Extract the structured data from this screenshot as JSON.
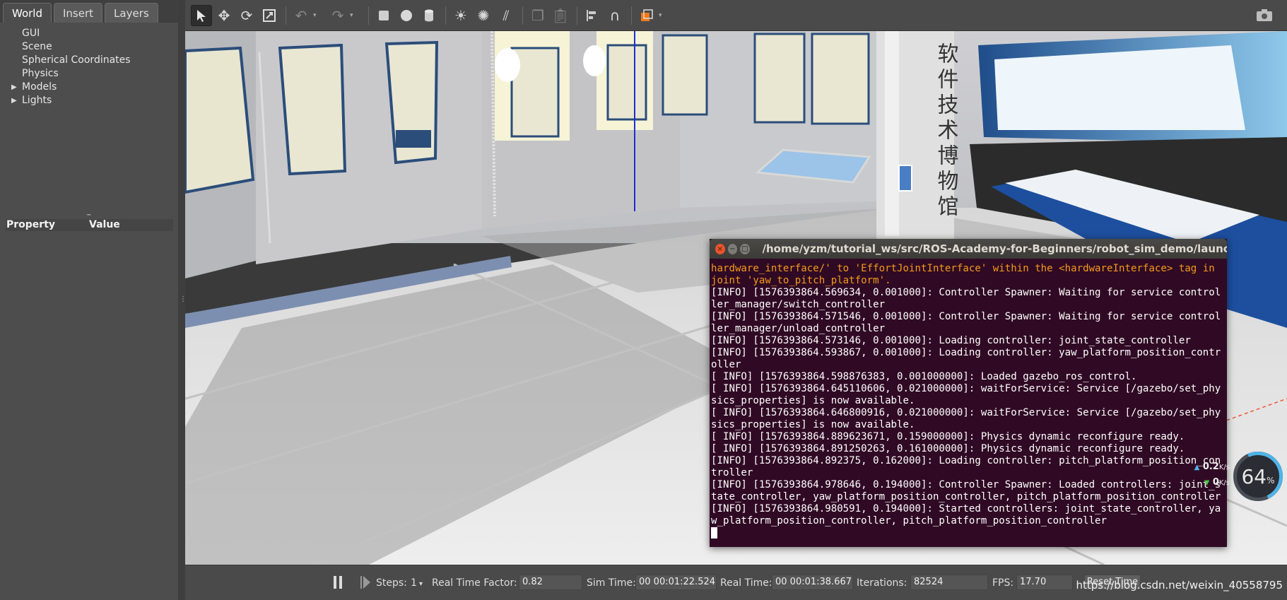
{
  "left_panel": {
    "tabs": [
      "World",
      "Insert",
      "Layers"
    ],
    "tree": [
      {
        "label": "GUI",
        "expandable": false
      },
      {
        "label": "Scene",
        "expandable": false
      },
      {
        "label": "Spherical Coordinates",
        "expandable": false
      },
      {
        "label": "Physics",
        "expandable": false
      },
      {
        "label": "Models",
        "expandable": true
      },
      {
        "label": "Lights",
        "expandable": true
      }
    ],
    "property_header": "Property",
    "value_header": "Value"
  },
  "toolbar": {
    "tools": [
      "select-icon",
      "translate-icon",
      "rotate-icon",
      "scale-icon",
      "undo-icon",
      "redo-icon",
      "box-icon",
      "sphere-icon",
      "cylinder-icon",
      "point-light-icon",
      "spot-light-icon",
      "directional-light-icon",
      "copy-icon",
      "paste-icon",
      "align-icon",
      "snap-icon",
      "change-view-icon",
      "screenshot-icon"
    ]
  },
  "viewport": {
    "sign_text": "软件技术博物馆"
  },
  "terminal": {
    "title": "/home/yzm/tutorial_ws/src/ROS-Academy-for-Beginners/robot_sim_demo/launch/robot_",
    "lines": [
      {
        "text": "hardware_interface/' to 'EffortJointInterface' within the <hardwareInterface> tag in joint 'yaw_to_pitch_platform'.",
        "warn": true
      },
      {
        "text": "[INFO] [1576393864.569634, 0.001000]: Controller Spawner: Waiting for service controller_manager/switch_controller",
        "warn": false
      },
      {
        "text": "[INFO] [1576393864.571546, 0.001000]: Controller Spawner: Waiting for service controller_manager/unload_controller",
        "warn": false
      },
      {
        "text": "[INFO] [1576393864.573146, 0.001000]: Loading controller: joint_state_controller",
        "warn": false
      },
      {
        "text": "[INFO] [1576393864.593867, 0.001000]: Loading controller: yaw_platform_position_controller",
        "warn": false
      },
      {
        "text": "[ INFO] [1576393864.598876383, 0.001000000]: Loaded gazebo_ros_control.",
        "warn": false
      },
      {
        "text": "[ INFO] [1576393864.645110606, 0.021000000]: waitForService: Service [/gazebo/set_physics_properties] is now available.",
        "warn": false
      },
      {
        "text": "[ INFO] [1576393864.646800916, 0.021000000]: waitForService: Service [/gazebo/set_physics_properties] is now available.",
        "warn": false
      },
      {
        "text": "[ INFO] [1576393864.889623671, 0.159000000]: Physics dynamic reconfigure ready.",
        "warn": false
      },
      {
        "text": "[ INFO] [1576393864.891250263, 0.161000000]: Physics dynamic reconfigure ready.",
        "warn": false
      },
      {
        "text": "[INFO] [1576393864.892375, 0.162000]: Loading controller: pitch_platform_position_controller",
        "warn": false
      },
      {
        "text": "[INFO] [1576393864.978646, 0.194000]: Controller Spawner: Loaded controllers: joint_state_controller, yaw_platform_position_controller, pitch_platform_position_controller",
        "warn": false
      },
      {
        "text": "[INFO] [1576393864.980591, 0.194000]: Started controllers: joint_state_controller, yaw_platform_position_controller, pitch_platform_position_controller",
        "warn": false
      }
    ]
  },
  "net_widget": {
    "percent": "64",
    "percent_unit": "%",
    "upload": "0.2",
    "download": "0",
    "unit": "K/s"
  },
  "status": {
    "steps_label": "Steps:",
    "steps_value": "1",
    "rtf_label": "Real Time Factor:",
    "rtf_value": "0.82",
    "sim_time_label": "Sim Time:",
    "sim_time_value": "00 00:01:22.524",
    "real_time_label": "Real Time:",
    "real_time_value": "00 00:01:38.667",
    "iterations_label": "Iterations:",
    "iterations_value": "82524",
    "fps_label": "FPS:",
    "fps_value": "17.70",
    "reset_label": "Reset Time",
    "watermark": "https://blog.csdn.net/weixin_40558795"
  },
  "colors": {
    "terminal_bg": "#300a24",
    "warn_text": "#f49a1a",
    "panel_bg": "#4d4d4d"
  }
}
